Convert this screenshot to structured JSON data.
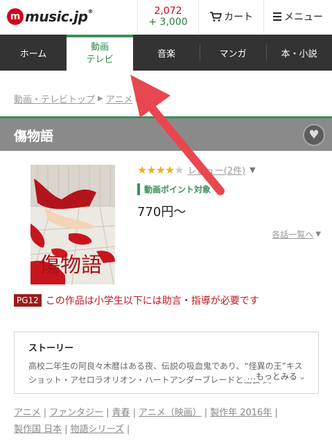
{
  "header": {
    "logo_text": "music.jp",
    "logo_mark": "m",
    "logo_reg": "®",
    "points_red": "2,072",
    "points_green": "+ 3,000",
    "cart_label": "カート",
    "cart_icon": "cart-icon",
    "menu_label": "メニュー",
    "menu_icon": "hamburger-icon"
  },
  "nav": {
    "items": [
      {
        "label": "ホーム"
      },
      {
        "label_line1": "動画",
        "label_line2": "テレビ",
        "active": true
      },
      {
        "label": "音楽"
      },
      {
        "label": "マンガ"
      },
      {
        "label": "本・小説"
      }
    ]
  },
  "breadcrumb": {
    "links": [
      "動画・テレビトップ",
      "アニメ"
    ],
    "current": "物語"
  },
  "title": {
    "text": "傷物語",
    "favorite_icon": "heart-icon"
  },
  "cover": {
    "caption": "傷物語"
  },
  "info": {
    "rating_stars": 4,
    "rating_max": 5,
    "review_label": "レビュー(2件)",
    "points_badge": "動画ポイント対象",
    "price": "770円〜",
    "episodes_link": "各話一覧へ"
  },
  "warning": {
    "badge": "PG12",
    "text": "この作品は小学生以下には助言・指導が必要です"
  },
  "story": {
    "heading": "ストーリー",
    "text": "高校二年生の阿良々木暦はある夜、伝説の吸血鬼であり、“怪異の王”キスショット・アセロラオリオン・ハートアンダーブレードと出会う。",
    "more_label": "…もっとみる"
  },
  "tags": [
    "アニメ",
    "ファンタジー",
    "青春",
    "アニメ（映画）",
    "製作年 2016年",
    "製作国 日本",
    "物語シリーズ"
  ],
  "colors": {
    "accent_green": "#3c8f5a",
    "brand_red": "#d0021b",
    "nav_bg": "#333333",
    "title_bar": "#8a8a8a",
    "arrow_red": "#e8474f"
  }
}
